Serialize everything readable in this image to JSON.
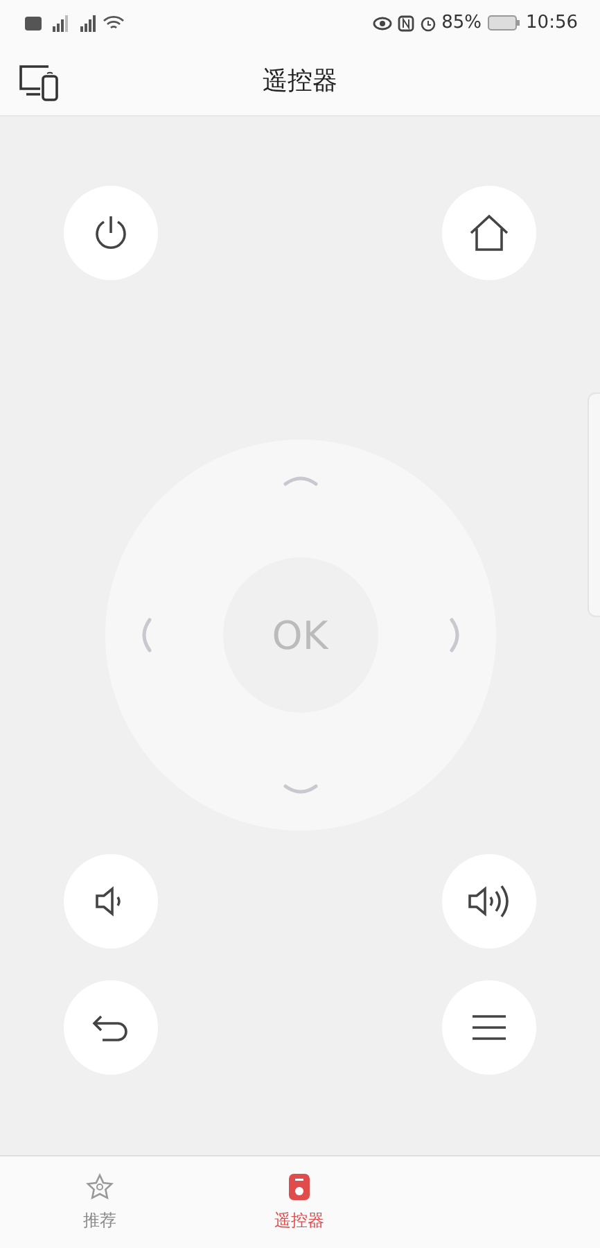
{
  "status_bar": {
    "battery": "85%",
    "time": "10:56"
  },
  "header": {
    "title": "遥控器"
  },
  "remote": {
    "ok_label": "OK"
  },
  "tabs": [
    {
      "label": "推荐",
      "kind": "star",
      "selected": false
    },
    {
      "label": "遥控器",
      "kind": "remote",
      "selected": true
    }
  ]
}
